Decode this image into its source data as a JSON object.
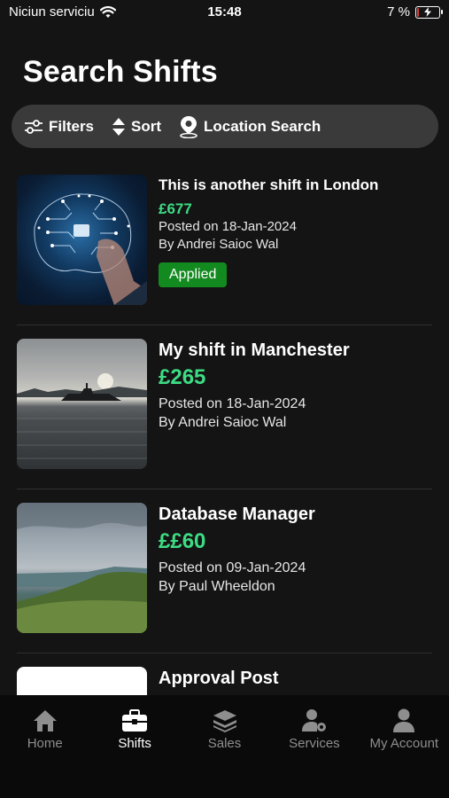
{
  "status_bar": {
    "carrier": "Niciun serviciu",
    "time": "15:48",
    "battery_percent": "7 %",
    "battery_level": 0.07
  },
  "page": {
    "title": "Search Shifts"
  },
  "toolbar": {
    "filters_label": "Filters",
    "sort_label": "Sort",
    "location_label": "Location Search"
  },
  "shifts": [
    {
      "title": "This is another shift in London",
      "price": "£677",
      "posted": "Posted on 18-Jan-2024",
      "author": "By Andrei Saioc Wal",
      "badge": "Applied",
      "image": "ai-brain-image"
    },
    {
      "title": "My shift in Manchester",
      "price": "£265",
      "posted": "Posted on 18-Jan-2024",
      "author": "By Andrei Saioc Wal",
      "image": "boat-lake-image"
    },
    {
      "title": "Database Manager",
      "price": "££60",
      "posted": "Posted on 09-Jan-2024",
      "author": "By Paul Wheeldon",
      "image": "coastline-image"
    },
    {
      "title": "Approval Post",
      "image": "blank-image"
    }
  ],
  "tabbar": {
    "items": [
      {
        "label": "Home",
        "icon": "home-icon"
      },
      {
        "label": "Shifts",
        "icon": "briefcase-icon",
        "active": true
      },
      {
        "label": "Sales",
        "icon": "layers-icon"
      },
      {
        "label": "Services",
        "icon": "user-gear-icon"
      },
      {
        "label": "My Account",
        "icon": "user-icon"
      }
    ]
  },
  "colors": {
    "background": "#141414",
    "toolbar": "#3a3a3a",
    "price": "#3ddc84",
    "badge": "#138a1f",
    "tabbar": "#0a0a0a"
  }
}
